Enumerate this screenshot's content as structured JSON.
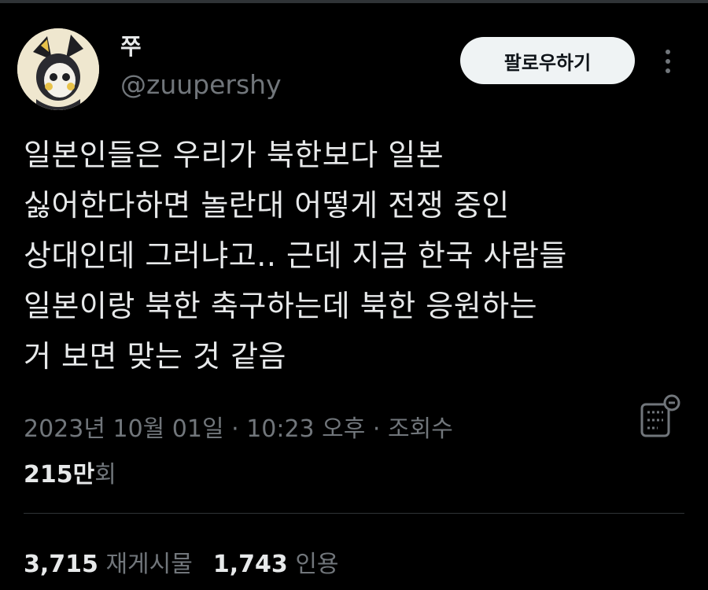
{
  "user": {
    "display_name": "쭈",
    "handle": "@zuupershy"
  },
  "header": {
    "follow_label": "팔로우하기"
  },
  "tweet": {
    "lines": [
      "일본인들은 우리가 북한보다 일본",
      "싫어한다하면 놀란대 어떻게 전쟁 중인",
      "상대인데 그러냐고.. 근데 지금 한국 사람들",
      "일본이랑 북한 축구하는데 북한 응원하는",
      "거 보면 맞는 것 같음"
    ]
  },
  "meta": {
    "date": "2023년 10월 01일",
    "separator": " · ",
    "time": "10:23 오후",
    "views_label": "조회수",
    "views_count": "215만",
    "views_unit": "회"
  },
  "stats": {
    "reposts_count": "3,715",
    "reposts_label": "재게시물",
    "quotes_count": "1,743",
    "quotes_label": "인용"
  },
  "colors": {
    "background": "#000000",
    "text_primary": "#e7e9ea",
    "text_secondary": "#71767b",
    "button_bg": "#eff3f4"
  },
  "icons": {
    "more": "more-dots-icon",
    "analytics": "analytics-list-icon"
  }
}
